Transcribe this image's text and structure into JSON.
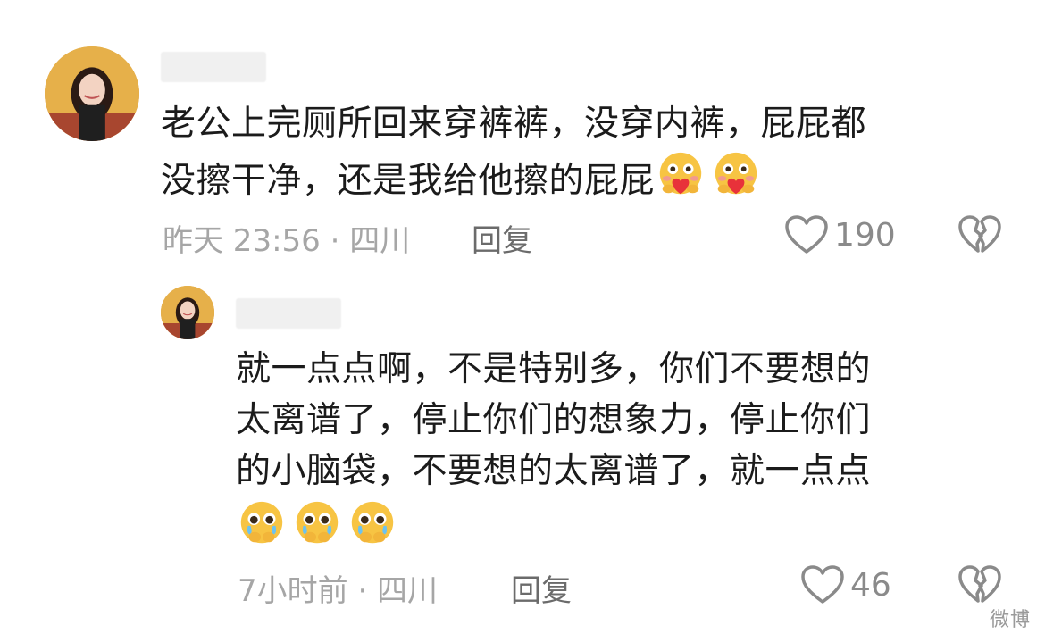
{
  "comment1": {
    "text_line1": "老公上完厕所回来穿裤裤，没穿内裤，屁屁都",
    "text_line2": "没擦干净，还是我给他擦的屁屁",
    "emojis": [
      "heart-hug-emoji",
      "heart-hug-emoji"
    ],
    "meta": "昨天 23:56 · 四川",
    "reply_label": "回复",
    "like_count": "190"
  },
  "comment2": {
    "text_line1": "就一点点啊，不是特别多，你们不要想的",
    "text_line2": "太离谱了，停止你们的想象力，停止你们",
    "text_line3": "的小脑袋，不要想的太离谱了，就一点点",
    "emojis": [
      "pleading-emoji",
      "pleading-emoji",
      "pleading-emoji"
    ],
    "meta": "7小时前 · 四川",
    "reply_label": "回复",
    "like_count": "46"
  },
  "watermark": "微博",
  "colors": {
    "text": "#1b1b1b",
    "meta": "#a6a6a6",
    "reply": "#6b6b6b",
    "icon": "#8a8a8a"
  },
  "icons": [
    "heart-outline-icon",
    "broken-heart-icon"
  ]
}
